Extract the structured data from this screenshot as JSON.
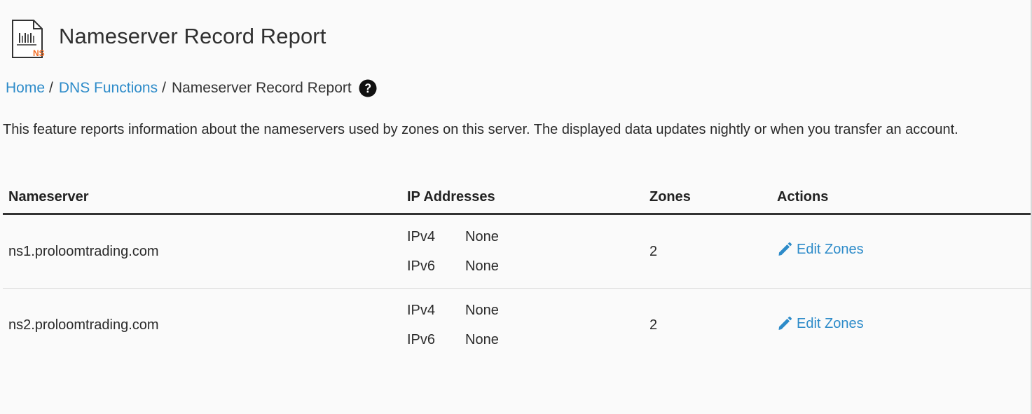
{
  "header": {
    "title": "Nameserver Record Report",
    "icon": "ns-report-icon",
    "icon_badge": "NS",
    "icon_accent": "#f26b21"
  },
  "breadcrumb": {
    "items": [
      {
        "label": "Home"
      },
      {
        "label": "DNS Functions"
      }
    ],
    "separator": "/",
    "current": "Nameserver Record Report",
    "help_icon": "question-circle-icon"
  },
  "description": "This feature reports information about the nameservers used by zones on this server. The displayed data updates nightly or when you transfer an account.",
  "table": {
    "columns": [
      "Nameserver",
      "IP Addresses",
      "Zones",
      "Actions"
    ],
    "rows": [
      {
        "nameserver": "ns1.proloomtrading.com",
        "ips": [
          {
            "type": "IPv4",
            "value": "None"
          },
          {
            "type": "IPv6",
            "value": "None"
          }
        ],
        "zones": "2",
        "action_label": "Edit Zones",
        "action_icon": "pencil-icon"
      },
      {
        "nameserver": "ns2.proloomtrading.com",
        "ips": [
          {
            "type": "IPv4",
            "value": "None"
          },
          {
            "type": "IPv6",
            "value": "None"
          }
        ],
        "zones": "2",
        "action_label": "Edit Zones",
        "action_icon": "pencil-icon"
      }
    ]
  },
  "colors": {
    "link": "#2d8bc9",
    "accent": "#f26b21",
    "background": "#fafafa"
  }
}
